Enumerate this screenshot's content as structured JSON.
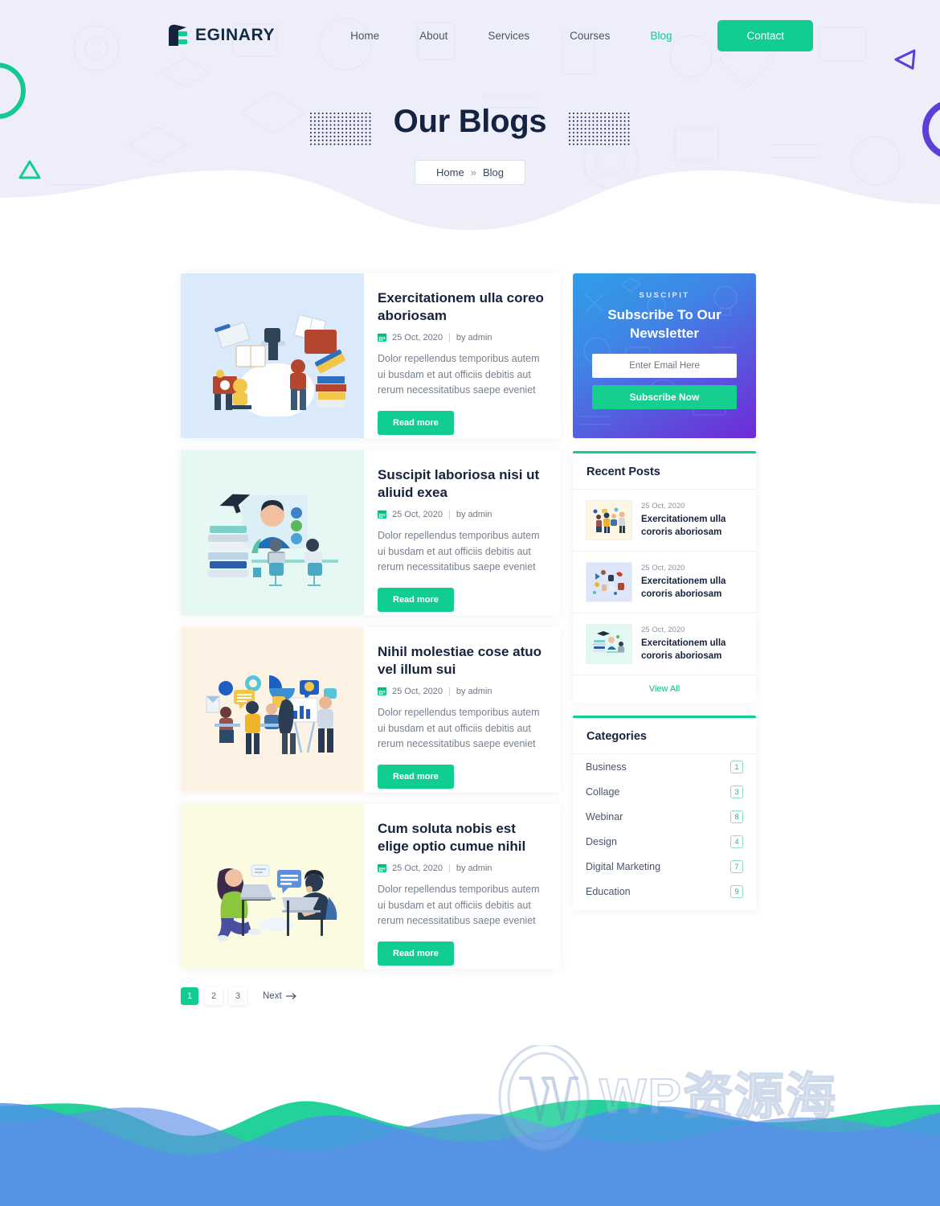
{
  "nav": {
    "brand": "EGINARY",
    "brand_icon": "eginary-logo-icon",
    "links": [
      {
        "label": "Home",
        "active": false
      },
      {
        "label": "About",
        "active": false
      },
      {
        "label": "Services",
        "active": false
      },
      {
        "label": "Courses",
        "active": false
      },
      {
        "label": "Blog",
        "active": true
      }
    ],
    "contact_label": "Contact"
  },
  "hero": {
    "title": "Our Blogs",
    "breadcrumb_home": "Home",
    "breadcrumb_sep": "»",
    "breadcrumb_current": "Blog"
  },
  "posts": [
    {
      "title": "Exercitationem ulla coreo aboriosam",
      "date": "25 Oct, 2020",
      "author": "by admin",
      "excerpt": "Dolor repellendus temporibus autem ui busdam et aut officiis debitis aut rerum necessitatibus saepe eveniet",
      "read_more": "Read more",
      "thumb_bg": "#dbeafb",
      "thumb_alt": "people-with-books-illustration"
    },
    {
      "title": "Suscipit laboriosa nisi ut aliuid exea",
      "date": "25 Oct, 2020",
      "author": "by admin",
      "excerpt": "Dolor repellendus temporibus autem ui busdam et aut officiis debitis aut rerum necessitatibus saepe eveniet",
      "read_more": "Read more",
      "thumb_bg": "#e5f8f3",
      "thumb_alt": "online-class-illustration"
    },
    {
      "title": "Nihil molestiae cose atuo vel illum sui",
      "date": "25 Oct, 2020",
      "author": "by admin",
      "excerpt": "Dolor repellendus temporibus autem ui busdam et aut officiis debitis aut rerum necessitatibus saepe eveniet",
      "read_more": "Read more",
      "thumb_bg": "#fdf3e4",
      "thumb_alt": "team-meeting-illustration"
    },
    {
      "title": "Cum soluta nobis est elige optio cumue nihil",
      "date": "25 Oct, 2020",
      "author": "by admin",
      "excerpt": "Dolor repellendus temporibus autem ui busdam et aut officiis debitis aut rerum necessitatibus saepe eveniet",
      "read_more": "Read more",
      "thumb_bg": "#fbfbe2",
      "thumb_alt": "two-people-laptops-illustration"
    }
  ],
  "pagination": {
    "pages": [
      "1",
      "2",
      "3"
    ],
    "active_page": "1",
    "next_label": "Next",
    "next_icon": "arrow-right-icon"
  },
  "newsletter": {
    "kicker": "SUSCIPIT",
    "title": "Subscribe To Our Newsletter",
    "email_placeholder": "Enter Email Here",
    "email_value": "",
    "button_label": "Subscribe Now"
  },
  "recent_posts": {
    "title": "Recent Posts",
    "items": [
      {
        "date": "25 Oct, 2020",
        "title": "Exercitationem ulla cororis aboriosam",
        "thumb_bg": "#fdf6e3"
      },
      {
        "date": "25 Oct, 2020",
        "title": "Exercitationem ulla cororis aboriosam",
        "thumb_bg": "#dde6f8"
      },
      {
        "date": "25 Oct, 2020",
        "title": "Exercitationem ulla cororis aboriosam",
        "thumb_bg": "#e3f8f2"
      }
    ],
    "view_all": "View All"
  },
  "categories": {
    "title": "Categories",
    "items": [
      {
        "label": "Business",
        "count": "1"
      },
      {
        "label": "Collage",
        "count": "3"
      },
      {
        "label": "Webinar",
        "count": "8"
      },
      {
        "label": "Design",
        "count": "4"
      },
      {
        "label": "Digital Marketing",
        "count": "7"
      },
      {
        "label": "Education",
        "count": "9"
      }
    ]
  },
  "watermark": {
    "logo_icon": "wordpress-icon",
    "text": "WP资源海"
  },
  "colors": {
    "accent_green": "#12cd92",
    "dark_navy": "#16233d",
    "hero_bg": "#eeeefb",
    "purple": "#5b3fd6"
  }
}
